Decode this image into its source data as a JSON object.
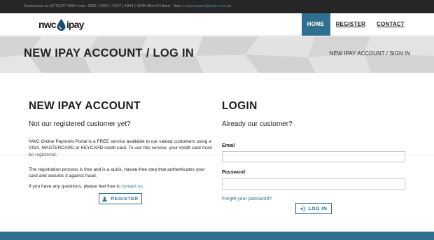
{
  "topbar": {
    "contact_text": "Contact us on (876)727-6054 exts. 4326 | 4326 | 4327 | 4344 | 4345 Mon-Fri 8am - 4pm | ",
    "email": "ipaysupport@nwc.com.jm"
  },
  "logo": {
    "left_text": "nwc",
    "right_text": "ipay"
  },
  "nav": {
    "items": [
      "HOME",
      "REGISTER",
      "CONTACT"
    ]
  },
  "banner": {
    "title": "NEW IPAY ACCOUNT / LOG IN",
    "breadcrumb": [
      "NEW IPAY ACCOUNT",
      "SIGN IN"
    ],
    "breadcrumb_sep": " / "
  },
  "register": {
    "title": "NEW IPAY ACCOUNT",
    "subtitle": "Not our registered customer yet?",
    "para1": "NWC Online Payment Portal is a FREE service available to our valued customers using a VISA, MASTERCARD or KEYCARD credit card. To use this service, your credit card must be registered.",
    "para2": "The registration process is free and is a quick, hassle-free step that authenticates your card and secures it against fraud.",
    "para3_prefix": "If you have any questions, please feel free to ",
    "para3_link": "contact us",
    "para3_suffix": ".",
    "button_label": "REGISTER"
  },
  "login": {
    "title": "LOGIN",
    "subtitle": "Already our customer?",
    "email_label": "Email",
    "email_value": "",
    "password_label": "Password",
    "password_value": "",
    "forgot_link": "Forget your password?",
    "button_label": "LOG IN"
  },
  "colors": {
    "accent": "#2f6f8f",
    "topbar_bg": "#262626",
    "banner_bg": "#dcdcdc"
  }
}
